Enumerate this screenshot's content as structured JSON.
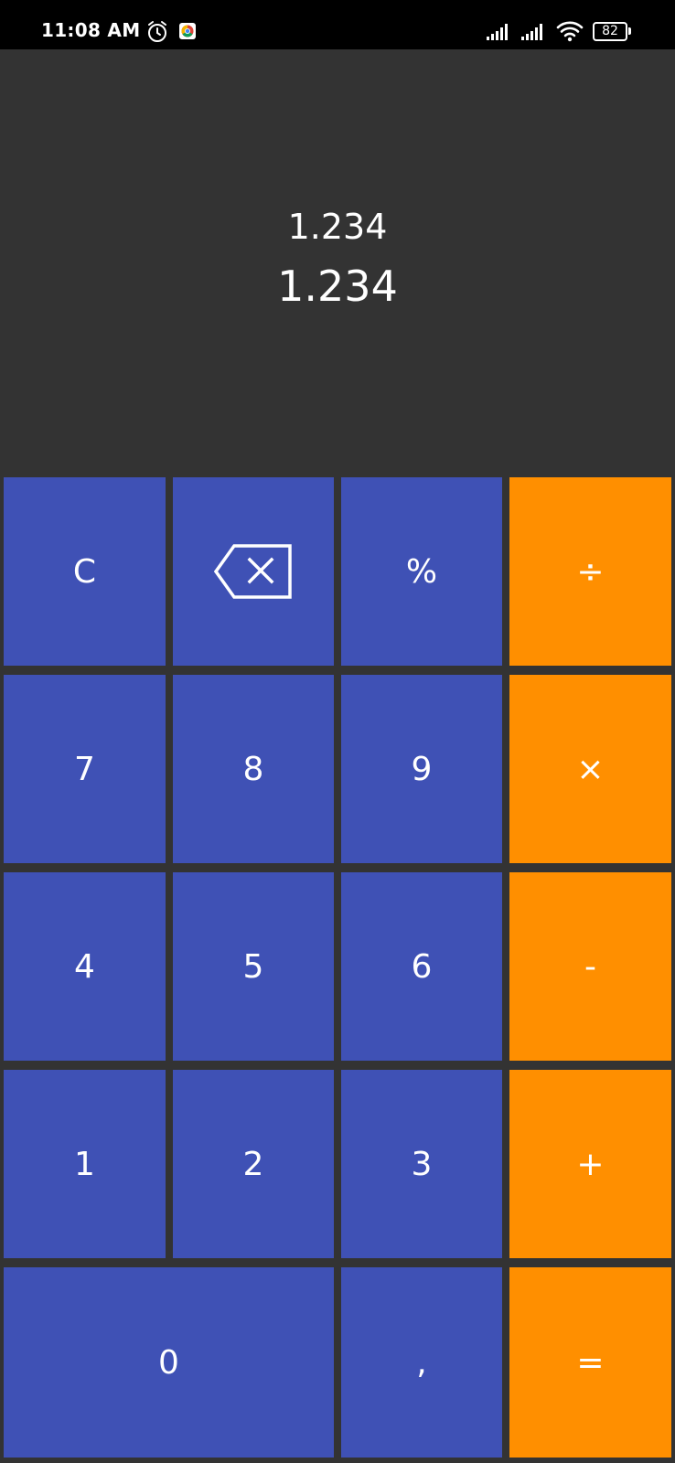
{
  "status_bar": {
    "time": "11:08 AM",
    "battery_level": "82",
    "icons": [
      "alarm-icon",
      "chrome-icon",
      "signal-icon",
      "signal-icon",
      "wifi-icon",
      "battery-icon"
    ]
  },
  "display": {
    "expression": "1.234",
    "result": "1.234"
  },
  "keypad": {
    "clear": "C",
    "backspace_icon": "backspace-icon",
    "percent": "%",
    "divide": "÷",
    "seven": "7",
    "eight": "8",
    "nine": "9",
    "multiply": "×",
    "four": "4",
    "five": "5",
    "six": "6",
    "minus": "-",
    "one": "1",
    "two": "2",
    "three": "3",
    "plus": "+",
    "zero": "0",
    "comma": ",",
    "equals": "="
  },
  "colors": {
    "background": "#333333",
    "status_bar": "#000000",
    "digit_key": "#3f51b5",
    "operator_key": "#ff8f00",
    "text": "#ffffff"
  }
}
